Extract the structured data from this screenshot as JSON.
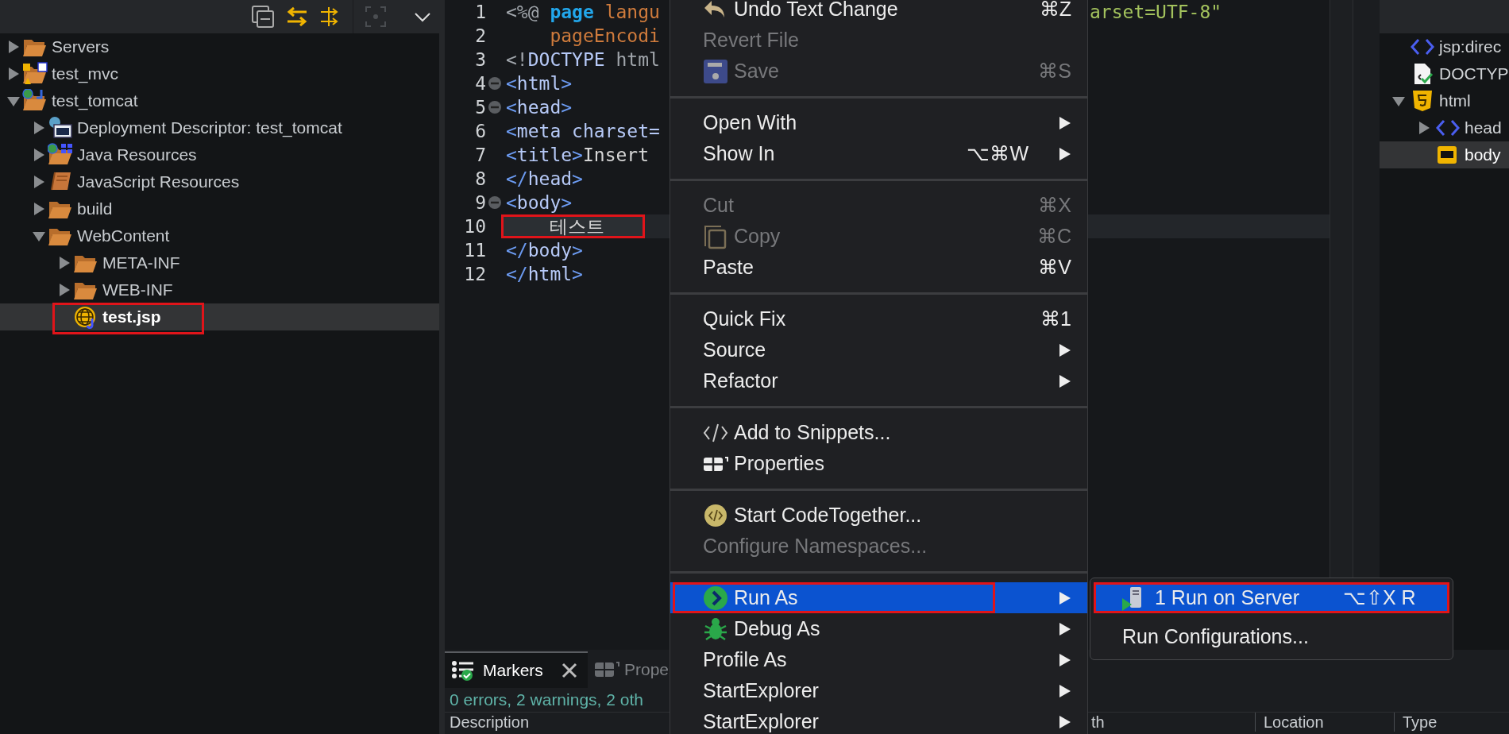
{
  "project_explorer": {
    "items": [
      {
        "label": "Servers",
        "kind": "folder",
        "expanded": false,
        "selected": false
      },
      {
        "label": "test_mvc",
        "kind": "mvc-project",
        "expanded": false,
        "selected": false
      },
      {
        "label": "test_tomcat",
        "kind": "web-project",
        "expanded": true,
        "selected": false,
        "children": [
          {
            "label": "Deployment Descriptor: test_tomcat",
            "kind": "descriptor",
            "expanded": false,
            "selected": false
          },
          {
            "label": "Java Resources",
            "kind": "java-resources",
            "expanded": false,
            "selected": false
          },
          {
            "label": "JavaScript Resources",
            "kind": "js-resources",
            "expanded": false,
            "selected": false
          },
          {
            "label": "build",
            "kind": "folder",
            "expanded": false,
            "selected": false
          },
          {
            "label": "WebContent",
            "kind": "folder",
            "expanded": true,
            "selected": false,
            "children": [
              {
                "label": "META-INF",
                "kind": "folder",
                "expanded": false,
                "selected": false
              },
              {
                "label": "WEB-INF",
                "kind": "folder",
                "expanded": false,
                "selected": false
              },
              {
                "label": "test.jsp",
                "kind": "jsp",
                "selected": true,
                "annotated": true
              }
            ]
          }
        ]
      }
    ]
  },
  "editor": {
    "lines": [
      {
        "number": "1",
        "fold": false,
        "current": false,
        "tokens": [
          {
            "kind": "punct",
            "text": "<%@ "
          },
          {
            "kind": "keyword",
            "text": "page"
          },
          {
            "kind": "attr",
            "text": " langu"
          }
        ],
        "tail": {
          "kind": "string",
          "text": "arset=UTF-8\""
        }
      },
      {
        "number": "2",
        "fold": false,
        "current": false,
        "tokens": [
          {
            "kind": "attr",
            "text": "    pageEncodi"
          }
        ]
      },
      {
        "number": "3",
        "fold": false,
        "current": false,
        "tokens": [
          {
            "kind": "punct",
            "text": "<!"
          },
          {
            "kind": "tag",
            "text": "DOCTYPE"
          },
          {
            "kind": "punct",
            "text": " html"
          }
        ]
      },
      {
        "number": "4",
        "fold": true,
        "current": false,
        "tokens": [
          {
            "kind": "bracket",
            "text": "<"
          },
          {
            "kind": "tag",
            "text": "html"
          },
          {
            "kind": "bracket",
            "text": ">"
          }
        ]
      },
      {
        "number": "5",
        "fold": true,
        "current": false,
        "tokens": [
          {
            "kind": "bracket",
            "text": "<"
          },
          {
            "kind": "tag",
            "text": "head"
          },
          {
            "kind": "bracket",
            "text": ">"
          }
        ]
      },
      {
        "number": "6",
        "fold": false,
        "current": false,
        "tokens": [
          {
            "kind": "bracket",
            "text": "<"
          },
          {
            "kind": "tag",
            "text": "meta charset="
          }
        ]
      },
      {
        "number": "7",
        "fold": false,
        "current": false,
        "tokens": [
          {
            "kind": "bracket",
            "text": "<"
          },
          {
            "kind": "tag",
            "text": "title"
          },
          {
            "kind": "bracket",
            "text": ">"
          },
          {
            "kind": "text",
            "text": "Insert"
          }
        ]
      },
      {
        "number": "8",
        "fold": false,
        "current": false,
        "tokens": [
          {
            "kind": "bracket",
            "text": "</"
          },
          {
            "kind": "tag",
            "text": "head"
          },
          {
            "kind": "bracket",
            "text": ">"
          }
        ]
      },
      {
        "number": "9",
        "fold": true,
        "current": false,
        "tokens": [
          {
            "kind": "bracket",
            "text": "<"
          },
          {
            "kind": "tag",
            "text": "body"
          },
          {
            "kind": "bracket",
            "text": ">"
          }
        ]
      },
      {
        "number": "10",
        "fold": false,
        "current": true,
        "annotated": true,
        "tokens": [
          {
            "kind": "text",
            "text": "테스트"
          }
        ]
      },
      {
        "number": "11",
        "fold": false,
        "current": false,
        "tokens": [
          {
            "kind": "bracket",
            "text": "</"
          },
          {
            "kind": "tag",
            "text": "body"
          },
          {
            "kind": "bracket",
            "text": ">"
          }
        ]
      },
      {
        "number": "12",
        "fold": false,
        "current": false,
        "tokens": [
          {
            "kind": "bracket",
            "text": "</"
          },
          {
            "kind": "tag",
            "text": "html"
          },
          {
            "kind": "bracket",
            "text": ">"
          }
        ]
      }
    ]
  },
  "outline": {
    "items": [
      {
        "label": "jsp:direc",
        "kind": "tag",
        "selected": false
      },
      {
        "label": "DOCTYP",
        "kind": "doctype",
        "selected": false
      },
      {
        "label": "html",
        "kind": "html",
        "expanded": true,
        "selected": false,
        "children": [
          {
            "label": "head",
            "kind": "tag",
            "expanded": false,
            "selected": false
          },
          {
            "label": "body",
            "kind": "body",
            "selected": true
          }
        ]
      }
    ]
  },
  "bottom_panel": {
    "tabs": [
      {
        "label": "Markers",
        "selected": true
      },
      {
        "label": "Prope",
        "selected": false
      }
    ],
    "summary": "0 errors, 2 warnings, 2 oth",
    "columns": [
      "Description",
      "th",
      "Location",
      "Type"
    ]
  },
  "context_menu": {
    "items": [
      {
        "kind": "item",
        "label": "Undo Text Change",
        "shortcut": "⌘Z",
        "disabled": false,
        "submenu": false,
        "selected": false
      },
      {
        "kind": "item",
        "label": "Revert File",
        "disabled": true,
        "submenu": false,
        "selected": false
      },
      {
        "kind": "item",
        "label": "Save",
        "shortcut": "⌘S",
        "disabled": true,
        "submenu": false,
        "selected": false
      },
      {
        "kind": "separator"
      },
      {
        "kind": "item",
        "label": "Open With",
        "disabled": false,
        "submenu": true,
        "selected": false
      },
      {
        "kind": "item",
        "label": "Show In",
        "shortcut": "⌥⌘W",
        "disabled": false,
        "submenu": true,
        "selected": false
      },
      {
        "kind": "separator"
      },
      {
        "kind": "item",
        "label": "Cut",
        "shortcut": "⌘X",
        "disabled": true,
        "submenu": false,
        "selected": false
      },
      {
        "kind": "item",
        "label": "Copy",
        "shortcut": "⌘C",
        "disabled": true,
        "submenu": false,
        "selected": false
      },
      {
        "kind": "item",
        "label": "Paste",
        "shortcut": "⌘V",
        "disabled": false,
        "submenu": false,
        "selected": false
      },
      {
        "kind": "separator"
      },
      {
        "kind": "item",
        "label": "Quick Fix",
        "shortcut": "⌘1",
        "disabled": false,
        "submenu": false,
        "selected": false
      },
      {
        "kind": "item",
        "label": "Source",
        "disabled": false,
        "submenu": true,
        "selected": false
      },
      {
        "kind": "item",
        "label": "Refactor",
        "disabled": false,
        "submenu": true,
        "selected": false
      },
      {
        "kind": "separator"
      },
      {
        "kind": "item",
        "label": "Add to Snippets...",
        "disabled": false,
        "submenu": false,
        "selected": false
      },
      {
        "kind": "item",
        "label": "Properties",
        "disabled": false,
        "submenu": false,
        "selected": false
      },
      {
        "kind": "separator"
      },
      {
        "kind": "item",
        "label": "Start CodeTogether...",
        "disabled": false,
        "submenu": false,
        "selected": false
      },
      {
        "kind": "item",
        "label": "Configure Namespaces...",
        "disabled": true,
        "submenu": false,
        "selected": false
      },
      {
        "kind": "separator"
      },
      {
        "kind": "item",
        "label": "Run As",
        "disabled": false,
        "submenu": true,
        "selected": true,
        "annotated": true
      },
      {
        "kind": "item",
        "label": "Debug As",
        "disabled": false,
        "submenu": true,
        "selected": false
      },
      {
        "kind": "item",
        "label": "Profile As",
        "disabled": false,
        "submenu": true,
        "selected": false
      },
      {
        "kind": "item",
        "label": "StartExplorer",
        "disabled": false,
        "submenu": true,
        "selected": false
      },
      {
        "kind": "item",
        "label": "StartExplorer",
        "disabled": false,
        "submenu": true,
        "selected": false
      }
    ]
  },
  "submenu": {
    "items": [
      {
        "label": "1 Run on Server",
        "shortcut": "⌥⇧X R",
        "selected": true,
        "annotated": true
      },
      {
        "label": "Run Configurations...",
        "selected": false
      }
    ]
  }
}
